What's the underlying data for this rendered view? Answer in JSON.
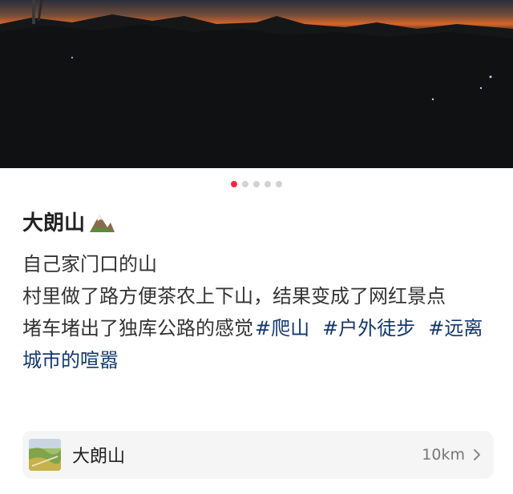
{
  "post": {
    "photo": {
      "description_icon": "sunset-mountain-photo",
      "carousel_count": 5,
      "carousel_active_index": 0
    },
    "title": "大朗山",
    "title_emoji": "mountain-icon",
    "lines": [
      "自己家门口的山",
      "村里做了路方便茶农上下山，结果变成了网红景点",
      "堵车堵出了独库公路的感觉"
    ],
    "tags": [
      "#爬山",
      "#户外徒步",
      "#远离城市的喧嚣"
    ],
    "location": {
      "name": "大朗山",
      "distance": "10km",
      "icon": "location-thumbnail"
    }
  },
  "colors": {
    "accent": "#ff2442",
    "tag": "#13386c",
    "card_bg": "#f5f5f5"
  }
}
